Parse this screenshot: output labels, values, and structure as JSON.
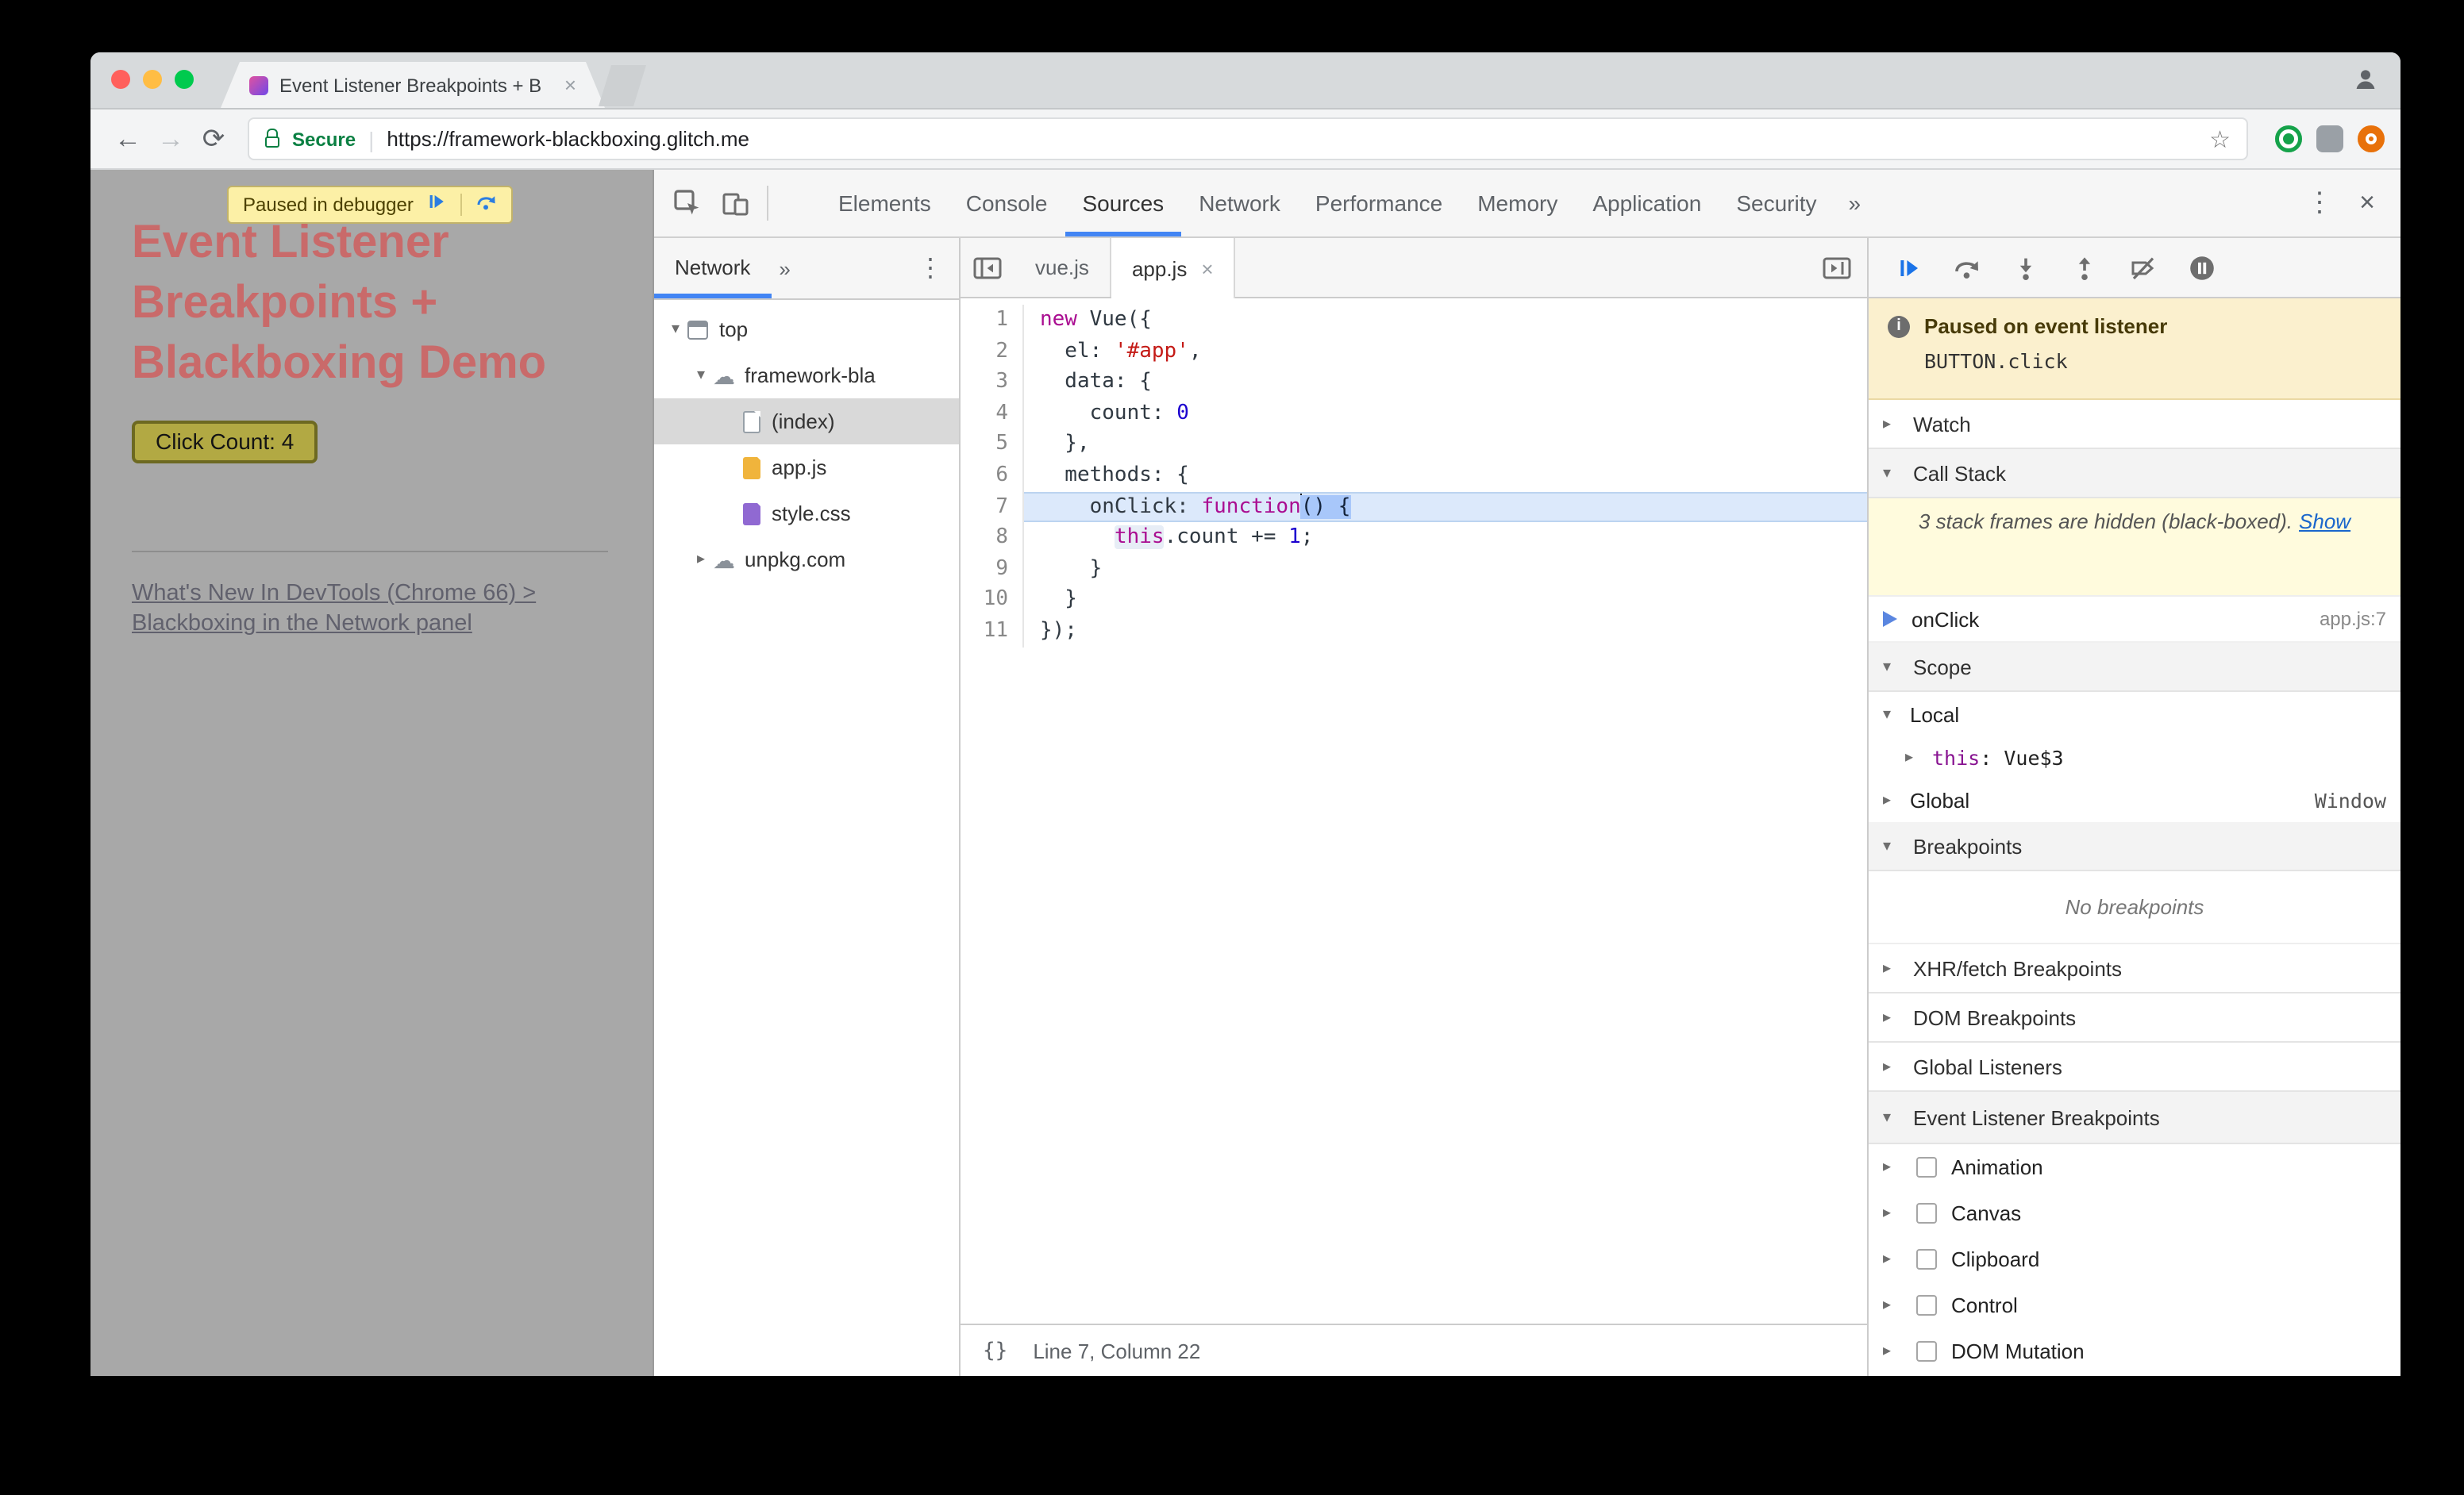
{
  "colors": {
    "accent": "#4285f4",
    "keyword": "#aa0d91",
    "string": "#c41a16",
    "number": "#1c00cf",
    "exec_bg": "#dce9fb",
    "exec_border": "#bcd4f0",
    "select_bg": "#a8c7fa",
    "soft_bg": "#e7edf6",
    "paused_bg": "#fbf0ce",
    "notice_bg": "#fffbdd",
    "heading": "#c96a6a",
    "secure_green": "#0b8043",
    "link_blue": "#1a66cc"
  },
  "glyphs": {
    "back": "←",
    "forward": "→",
    "reload": "⟳",
    "star": "☆",
    "sep": "|",
    "more": "»",
    "kebab": "⋮",
    "close": "×",
    "tw_open": "▾",
    "tw_closed": "▸",
    "cloud": "☁",
    "braces": "{}"
  },
  "browser": {
    "tab_title": "Event Listener Breakpoints + B",
    "secure_label": "Secure",
    "url": "https://framework-blackboxing.glitch.me"
  },
  "page": {
    "debugger_banner": "Paused in debugger",
    "heading": "Event Listener Breakpoints + Blackboxing Demo",
    "click_button": "Click Count: 4",
    "link_line1": "What's New In DevTools (Chrome 66) >",
    "link_line2": "Blackboxing in the Network panel"
  },
  "devtools": {
    "active_tab": "Sources",
    "tabs": [
      "Elements",
      "Console",
      "Sources",
      "Network",
      "Performance",
      "Memory",
      "Application",
      "Security"
    ],
    "navigator": {
      "tab_label": "Network",
      "tree": [
        {
          "label": "top",
          "icon": "frame",
          "depth": 0,
          "exp": "open"
        },
        {
          "label": "framework-bla",
          "icon": "cloud",
          "depth": 1,
          "exp": "open"
        },
        {
          "label": "(index)",
          "icon": "file",
          "outline": true,
          "color": "#ffffff",
          "depth": 2,
          "selected": true
        },
        {
          "label": "app.js",
          "icon": "file",
          "color": "#f0b43c",
          "depth": 2
        },
        {
          "label": "style.css",
          "icon": "file",
          "color": "#9069d2",
          "depth": 2
        },
        {
          "label": "unpkg.com",
          "icon": "cloud",
          "depth": 1,
          "exp": "closed"
        }
      ]
    },
    "editor": {
      "tabs": [
        {
          "label": "vue.js",
          "active": false,
          "closable": false
        },
        {
          "label": "app.js",
          "active": true,
          "closable": true
        }
      ],
      "status": "Line 7, Column 22",
      "lines": [
        {
          "n": "1",
          "t": [
            [
              "new",
              "kw"
            ],
            [
              " Vue({",
              ""
            ]
          ]
        },
        {
          "n": "2",
          "t": [
            [
              "  el: ",
              ""
            ],
            [
              "'#app'",
              "str"
            ],
            [
              ",",
              ""
            ]
          ]
        },
        {
          "n": "3",
          "t": [
            [
              "  data: {",
              ""
            ]
          ]
        },
        {
          "n": "4",
          "t": [
            [
              "    count: ",
              ""
            ],
            [
              "0",
              "num"
            ]
          ]
        },
        {
          "n": "5",
          "t": [
            [
              "  },",
              ""
            ]
          ]
        },
        {
          "n": "6",
          "t": [
            [
              "  methods: {",
              ""
            ]
          ]
        },
        {
          "n": "7",
          "exec": true,
          "t": [
            [
              "    onClick: ",
              ""
            ],
            [
              "function",
              "kw"
            ],
            [
              "() {",
              "sel"
            ]
          ]
        },
        {
          "n": "8",
          "t": [
            [
              "      ",
              ""
            ],
            [
              "this",
              "kw soft"
            ],
            [
              ".count += ",
              ""
            ],
            [
              "1",
              "num"
            ],
            [
              ";",
              ""
            ]
          ]
        },
        {
          "n": "9",
          "t": [
            [
              "    }",
              ""
            ]
          ]
        },
        {
          "n": "10",
          "t": [
            [
              "  }",
              ""
            ]
          ]
        },
        {
          "n": "11",
          "t": [
            [
              "});",
              ""
            ]
          ]
        }
      ]
    },
    "debugger": {
      "paused_title": "Paused on event listener",
      "paused_detail": "BUTTON.click",
      "sections": {
        "watch": "Watch",
        "call_stack": "Call Stack",
        "scope": "Scope",
        "breakpoints": "Breakpoints",
        "xhr": "XHR/fetch Breakpoints",
        "dom": "DOM Breakpoints",
        "global_listeners": "Global Listeners",
        "event_listener": "Event Listener Breakpoints"
      },
      "callstack": {
        "notice": "3 stack frames are hidden (black-boxed).",
        "show_link": "Show",
        "frame_name": "onClick",
        "frame_location": "app.js:7"
      },
      "scope": {
        "local": "Local",
        "this_key": "this",
        "this_sep": ": ",
        "this_value": "Vue$3",
        "global": "Global",
        "global_value": "Window"
      },
      "breakpoints_empty": "No breakpoints",
      "event_categories": [
        "Animation",
        "Canvas",
        "Clipboard",
        "Control",
        "DOM Mutation"
      ]
    }
  }
}
